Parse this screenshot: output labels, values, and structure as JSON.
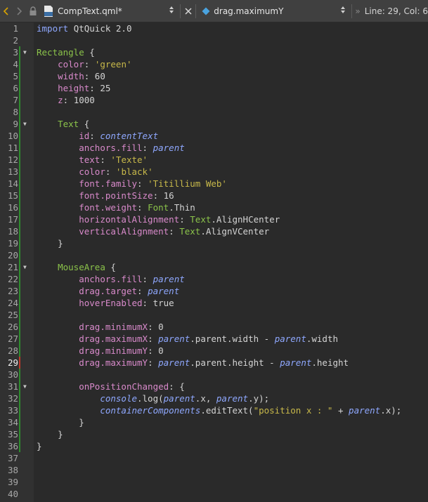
{
  "toolbar": {
    "file_name": "CompText.qml*",
    "file_icon_text": "qml",
    "symbol": "drag.maximumY",
    "position": "Line: 29, Col: 6",
    "nav_separator": "»"
  },
  "colors": {
    "keyword": "#8fa8ff",
    "type": "#8bc34a",
    "property": "#d98acb",
    "string": "#c8b94a",
    "change_marker": "#2e8b2e",
    "current_marker": "#c0392b"
  },
  "editor": {
    "current_line": 29,
    "lines": [
      {
        "n": "1",
        "fold": false,
        "t": [
          [
            "kw",
            "import "
          ],
          [
            "plain",
            "QtQuick 2.0"
          ]
        ]
      },
      {
        "n": "2",
        "fold": false,
        "t": []
      },
      {
        "n": "3",
        "fold": true,
        "t": [
          [
            "type",
            "Rectangle"
          ],
          [
            "plain",
            " {"
          ]
        ]
      },
      {
        "n": "4",
        "fold": false,
        "t": [
          [
            "plain",
            "    "
          ],
          [
            "prop",
            "color"
          ],
          [
            "plain",
            ": "
          ],
          [
            "str",
            "'green'"
          ]
        ]
      },
      {
        "n": "5",
        "fold": false,
        "t": [
          [
            "plain",
            "    "
          ],
          [
            "prop",
            "width"
          ],
          [
            "plain",
            ": 60"
          ]
        ]
      },
      {
        "n": "6",
        "fold": false,
        "t": [
          [
            "plain",
            "    "
          ],
          [
            "prop",
            "height"
          ],
          [
            "plain",
            ": 25"
          ]
        ]
      },
      {
        "n": "7",
        "fold": false,
        "t": [
          [
            "plain",
            "    "
          ],
          [
            "prop",
            "z"
          ],
          [
            "plain",
            ": 1000"
          ]
        ]
      },
      {
        "n": "8",
        "fold": false,
        "t": []
      },
      {
        "n": "9",
        "fold": true,
        "t": [
          [
            "plain",
            "    "
          ],
          [
            "type",
            "Text"
          ],
          [
            "plain",
            " {"
          ]
        ]
      },
      {
        "n": "10",
        "fold": false,
        "t": [
          [
            "plain",
            "        "
          ],
          [
            "prop",
            "id"
          ],
          [
            "plain",
            ": "
          ],
          [
            "id",
            "contentText"
          ]
        ]
      },
      {
        "n": "11",
        "fold": false,
        "t": [
          [
            "plain",
            "        "
          ],
          [
            "prop",
            "anchors.fill"
          ],
          [
            "plain",
            ": "
          ],
          [
            "id",
            "parent"
          ]
        ]
      },
      {
        "n": "12",
        "fold": false,
        "t": [
          [
            "plain",
            "        "
          ],
          [
            "prop",
            "text"
          ],
          [
            "plain",
            ": "
          ],
          [
            "str",
            "'Texte'"
          ]
        ]
      },
      {
        "n": "13",
        "fold": false,
        "t": [
          [
            "plain",
            "        "
          ],
          [
            "prop",
            "color"
          ],
          [
            "plain",
            ": "
          ],
          [
            "str",
            "'black'"
          ]
        ]
      },
      {
        "n": "14",
        "fold": false,
        "t": [
          [
            "plain",
            "        "
          ],
          [
            "prop",
            "font.family"
          ],
          [
            "plain",
            ": "
          ],
          [
            "str",
            "'Titillium Web'"
          ]
        ]
      },
      {
        "n": "15",
        "fold": false,
        "t": [
          [
            "plain",
            "        "
          ],
          [
            "prop",
            "font.pointSize"
          ],
          [
            "plain",
            ": 16"
          ]
        ]
      },
      {
        "n": "16",
        "fold": false,
        "t": [
          [
            "plain",
            "        "
          ],
          [
            "prop",
            "font.weight"
          ],
          [
            "plain",
            ": "
          ],
          [
            "type",
            "Font"
          ],
          [
            "plain",
            ".Thin"
          ]
        ]
      },
      {
        "n": "17",
        "fold": false,
        "t": [
          [
            "plain",
            "        "
          ],
          [
            "prop",
            "horizontalAlignment"
          ],
          [
            "plain",
            ": "
          ],
          [
            "type",
            "Text"
          ],
          [
            "plain",
            ".AlignHCenter"
          ]
        ]
      },
      {
        "n": "18",
        "fold": false,
        "t": [
          [
            "plain",
            "        "
          ],
          [
            "prop",
            "verticalAlignment"
          ],
          [
            "plain",
            ": "
          ],
          [
            "type",
            "Text"
          ],
          [
            "plain",
            ".AlignVCenter"
          ]
        ]
      },
      {
        "n": "19",
        "fold": false,
        "t": [
          [
            "plain",
            "    }"
          ]
        ]
      },
      {
        "n": "20",
        "fold": false,
        "t": []
      },
      {
        "n": "21",
        "fold": true,
        "t": [
          [
            "plain",
            "    "
          ],
          [
            "type",
            "MouseArea"
          ],
          [
            "plain",
            " {"
          ]
        ]
      },
      {
        "n": "22",
        "fold": false,
        "t": [
          [
            "plain",
            "        "
          ],
          [
            "prop",
            "anchors.fill"
          ],
          [
            "plain",
            ": "
          ],
          [
            "id",
            "parent"
          ]
        ]
      },
      {
        "n": "23",
        "fold": false,
        "t": [
          [
            "plain",
            "        "
          ],
          [
            "prop",
            "drag.target"
          ],
          [
            "plain",
            ": "
          ],
          [
            "id",
            "parent"
          ]
        ]
      },
      {
        "n": "24",
        "fold": false,
        "t": [
          [
            "plain",
            "        "
          ],
          [
            "prop",
            "hoverEnabled"
          ],
          [
            "plain",
            ": true"
          ]
        ]
      },
      {
        "n": "25",
        "fold": false,
        "t": []
      },
      {
        "n": "26",
        "fold": false,
        "t": [
          [
            "plain",
            "        "
          ],
          [
            "prop",
            "drag.minimumX"
          ],
          [
            "plain",
            ": 0"
          ]
        ]
      },
      {
        "n": "27",
        "fold": false,
        "t": [
          [
            "plain",
            "        "
          ],
          [
            "prop",
            "drag.maximumX"
          ],
          [
            "plain",
            ": "
          ],
          [
            "id",
            "parent"
          ],
          [
            "plain",
            ".parent.width - "
          ],
          [
            "id",
            "parent"
          ],
          [
            "plain",
            ".width"
          ]
        ]
      },
      {
        "n": "28",
        "fold": false,
        "t": [
          [
            "plain",
            "        "
          ],
          [
            "prop",
            "drag.minimumY"
          ],
          [
            "plain",
            ": 0"
          ]
        ]
      },
      {
        "n": "29",
        "fold": false,
        "t": [
          [
            "plain",
            "        "
          ],
          [
            "prop",
            "drag.maximumY"
          ],
          [
            "plain",
            ": "
          ],
          [
            "id",
            "parent"
          ],
          [
            "plain",
            ".parent.height - "
          ],
          [
            "id",
            "parent"
          ],
          [
            "plain",
            ".height"
          ]
        ]
      },
      {
        "n": "30",
        "fold": false,
        "t": []
      },
      {
        "n": "31",
        "fold": true,
        "t": [
          [
            "plain",
            "        "
          ],
          [
            "prop",
            "onPositionChanged"
          ],
          [
            "plain",
            ": {"
          ]
        ]
      },
      {
        "n": "32",
        "fold": false,
        "t": [
          [
            "plain",
            "            "
          ],
          [
            "id",
            "console"
          ],
          [
            "plain",
            ".log("
          ],
          [
            "id",
            "parent"
          ],
          [
            "plain",
            ".x, "
          ],
          [
            "id",
            "parent"
          ],
          [
            "plain",
            ".y);"
          ]
        ]
      },
      {
        "n": "33",
        "fold": false,
        "t": [
          [
            "plain",
            "            "
          ],
          [
            "id",
            "containerComponents"
          ],
          [
            "plain",
            ".editText("
          ],
          [
            "str",
            "\"position x : \""
          ],
          [
            "plain",
            " + "
          ],
          [
            "id",
            "parent"
          ],
          [
            "plain",
            ".x);"
          ]
        ]
      },
      {
        "n": "34",
        "fold": false,
        "t": [
          [
            "plain",
            "        }"
          ]
        ]
      },
      {
        "n": "35",
        "fold": false,
        "t": [
          [
            "plain",
            "    }"
          ]
        ]
      },
      {
        "n": "36",
        "fold": false,
        "t": [
          [
            "plain",
            "}"
          ]
        ]
      },
      {
        "n": "37",
        "fold": false,
        "t": []
      },
      {
        "n": "38",
        "fold": false,
        "t": []
      },
      {
        "n": "39",
        "fold": false,
        "t": []
      },
      {
        "n": "40",
        "fold": false,
        "t": []
      }
    ]
  }
}
